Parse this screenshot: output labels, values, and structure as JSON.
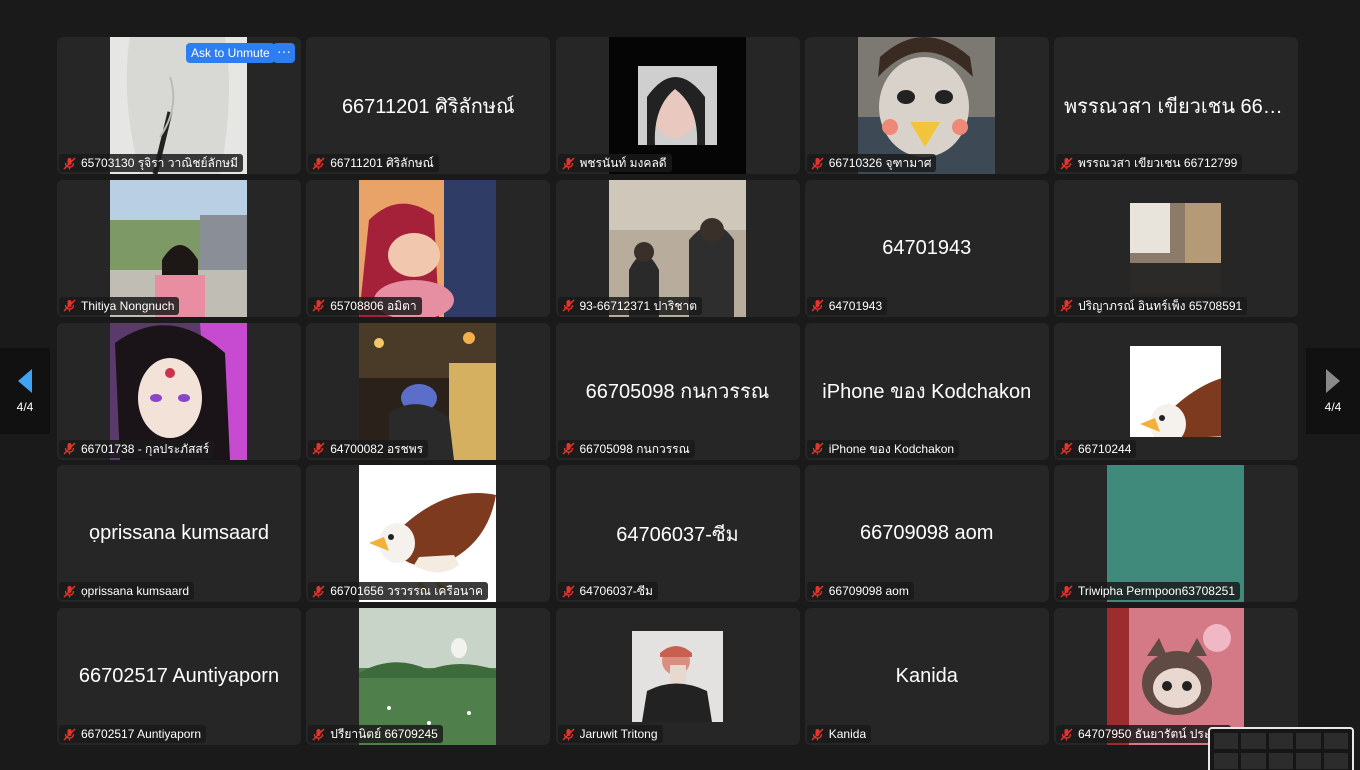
{
  "tiles": [
    {
      "id": "t1",
      "name": "65703130 รุจิรา วาณิชย์ลักษมี",
      "video": "tall",
      "bg": "#e6e6e4",
      "art": "coat"
    },
    {
      "id": "t2",
      "name": "66711201 ศิริลักษณ์",
      "big": "66711201 ศิริลักษณ์"
    },
    {
      "id": "t3",
      "name": "พชรนันท์ มงคลดี",
      "video": "tall",
      "bg": "#050505",
      "art": "face-box"
    },
    {
      "id": "t4",
      "name": "66710326 จุฑามาศ",
      "video": "tall",
      "bg": "#7c7872",
      "art": "face-duck"
    },
    {
      "id": "t5",
      "name": "พรรณวสา เขียวเชน 66712799",
      "big": "พรรณวสา เขียวเชน 6671..."
    },
    {
      "id": "t6",
      "name": "Thitiya Nongnuch",
      "video": "tall",
      "bg": "#b9d0e4",
      "art": "outdoor"
    },
    {
      "id": "t7",
      "name": "65708806 อมิตา",
      "video": "tall",
      "bg": "#e9a368",
      "art": "ariel"
    },
    {
      "id": "t8",
      "name": "93-66712371 ปาริชาต",
      "video": "tall",
      "bg": "#b8ad9c",
      "art": "couple"
    },
    {
      "id": "t9",
      "name": "64701943",
      "big": "64701943"
    },
    {
      "id": "t10",
      "name": "ปริญาภรณ์ อินทร์เพ็ง 65708591",
      "video": "sq",
      "bg": "#8c7b68",
      "art": "room"
    },
    {
      "id": "t11",
      "name": "66701738 - กุลประภัสสร์",
      "video": "tall",
      "bg": "#5a3a6a",
      "art": "anime"
    },
    {
      "id": "t12",
      "name": "64700082 อรชพร",
      "video": "tall",
      "bg": "#5b4a2e",
      "art": "night"
    },
    {
      "id": "t13",
      "name": "66705098 กนกวรรณ",
      "big": "66705098 กนกวรรณ"
    },
    {
      "id": "t14",
      "name": "iPhone ของ Kodchakon",
      "big": "iPhone ของ Kodchakon"
    },
    {
      "id": "t15",
      "name": "66710244",
      "video": "sq",
      "bg": "#ffffff",
      "art": "eagle"
    },
    {
      "id": "t16",
      "name": "ọprissana kumsaard",
      "big": "ọprissana kumsaard"
    },
    {
      "id": "t17",
      "name": "66701656 วรวรรณ เครือนาค",
      "video": "tall",
      "bg": "#ffffff",
      "art": "eagle"
    },
    {
      "id": "t18",
      "name": "64706037-ซีม",
      "big": "64706037-ซีม"
    },
    {
      "id": "t19",
      "name": "66709098 aom",
      "big": "66709098 aom"
    },
    {
      "id": "t20",
      "name": "Triwipha Permpoon63708251",
      "video": "tall",
      "bg": "#3f8a7a",
      "art": "plain"
    },
    {
      "id": "t21",
      "name": "66702517 Auntiyaporn",
      "big": "66702517 Auntiyaporn"
    },
    {
      "id": "t22",
      "name": "ปรียานิตย์ 66709245",
      "video": "tall",
      "bg": "#c8d4c8",
      "art": "meadow"
    },
    {
      "id": "t23",
      "name": "Jaruwit Tritong",
      "video": "sq",
      "bg": "#e4e2e0",
      "art": "selfie"
    },
    {
      "id": "t24",
      "name": "Kanida",
      "big": "Kanida"
    },
    {
      "id": "t25",
      "name": "64707950 ธันยารัตน์ ประทีป",
      "video": "tall",
      "bg": "#d37a86",
      "art": "plush"
    }
  ],
  "controls": {
    "ask_to_unmute": "Ask to Unmute",
    "more": "···",
    "prev_page": "4/4",
    "next_page": "4/4"
  },
  "icons": {
    "mute": "muted-mic-icon",
    "prev": "left-arrow-icon",
    "next": "right-arrow-icon"
  },
  "colors": {
    "accent": "#2d7ef0",
    "mute": "#e5352b",
    "tile": "#262626"
  }
}
